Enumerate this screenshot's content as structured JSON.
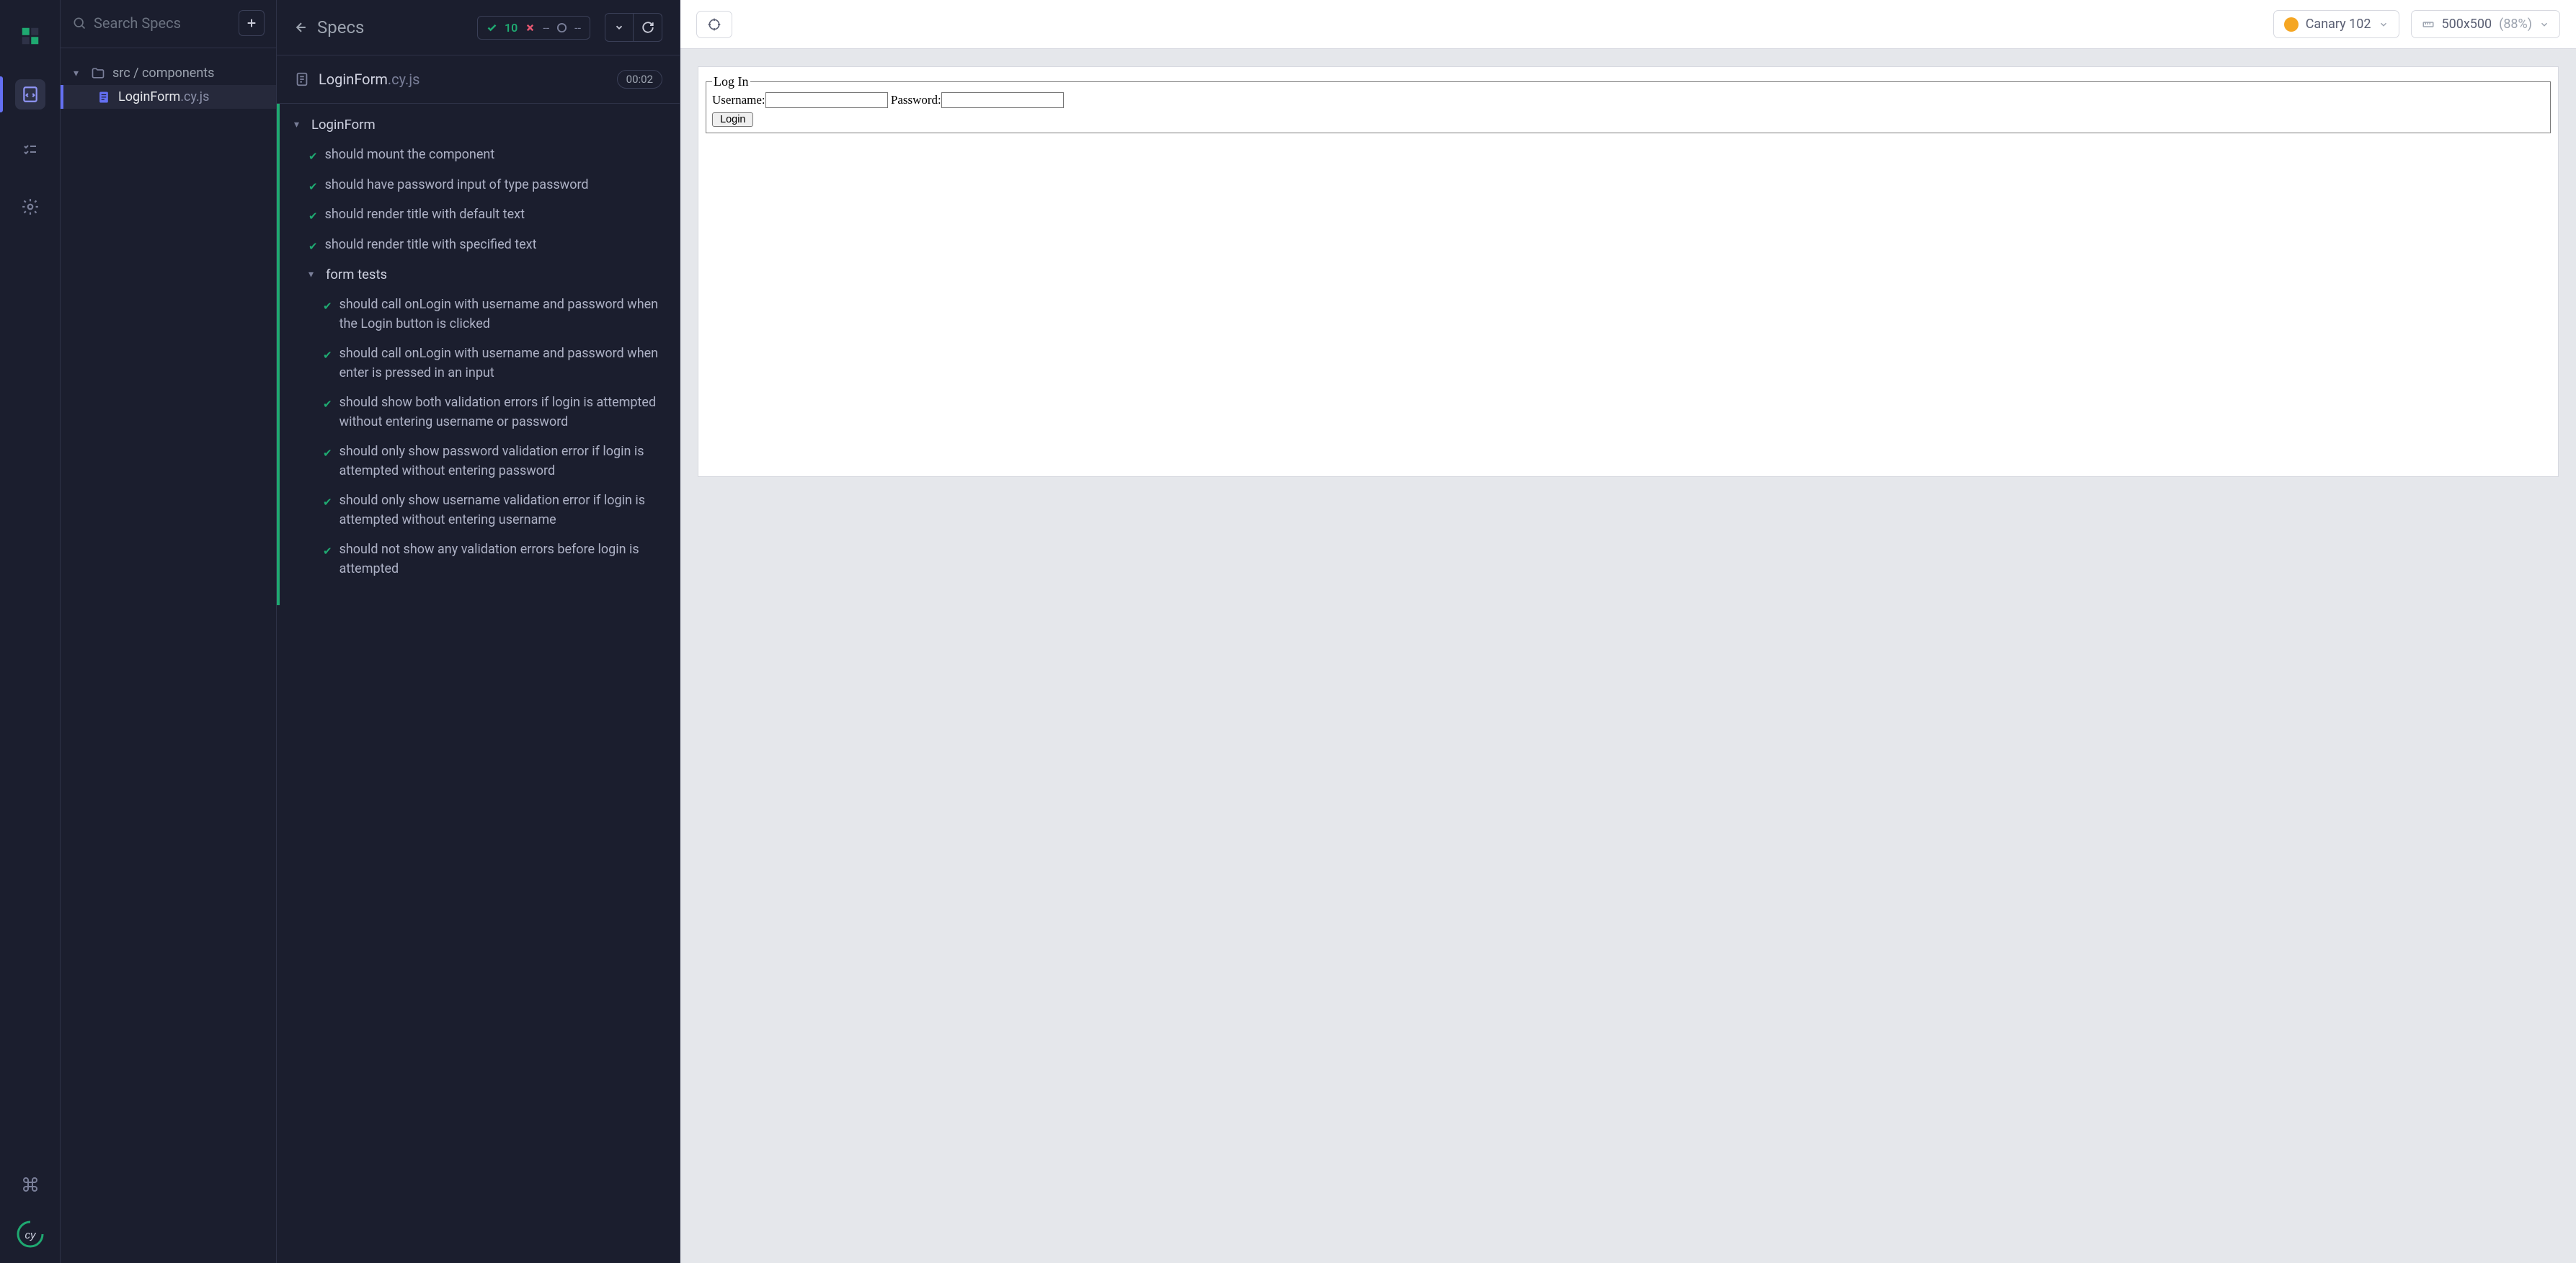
{
  "rail": {
    "items": [
      "specs",
      "runs",
      "settings"
    ]
  },
  "specs_panel": {
    "search_placeholder": "Search Specs",
    "folder_label": "src / components",
    "file_name": "LoginForm",
    "file_ext": ".cy.js"
  },
  "runner": {
    "back_label": "Specs",
    "stats": {
      "passed": "10",
      "failed": "--",
      "pending": "--"
    },
    "spec_name": "LoginForm",
    "spec_ext": ".cy.js",
    "duration": "00:02",
    "suite": "LoginForm",
    "tests": [
      "should mount the component",
      "should have password input of type password",
      "should render title with default text",
      "should render title with specified text"
    ],
    "sub_suite": "form tests",
    "sub_tests": [
      "should call onLogin with username and password when the Login button is clicked",
      "should call onLogin with username and password when enter is pressed in an input",
      "should show both validation errors if login is attempted without entering username or password",
      "should only show password validation error if login is attempted without entering password",
      "should only show username validation error if login is attempted without entering username",
      "should not show any validation errors before login is attempted"
    ]
  },
  "aut": {
    "browser": "Canary 102",
    "viewport_size": "500x500",
    "viewport_scale": "(88%)",
    "form": {
      "legend": "Log In",
      "username_label": "Username:",
      "password_label": "Password:",
      "login_button": "Login"
    }
  }
}
